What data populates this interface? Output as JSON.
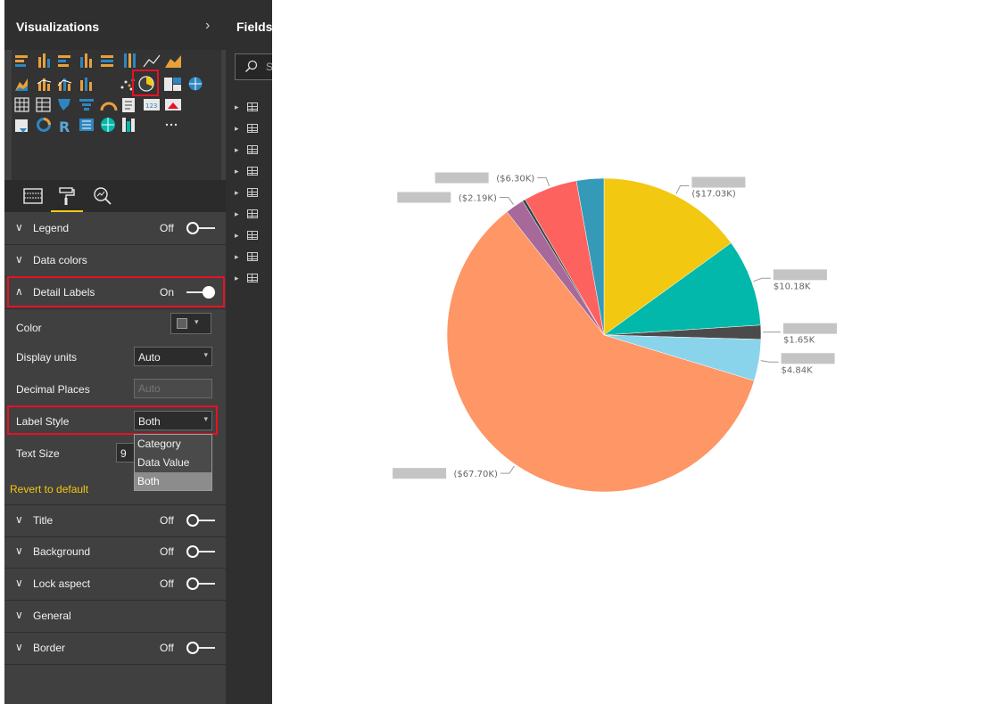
{
  "visualizations": {
    "title": "Visualizations",
    "collapse_icon": "chevron-right-icon",
    "tabs": [
      "fields-well-icon",
      "format-paint-roller-icon",
      "analytics-magnifier-icon"
    ],
    "icon_gallery": [
      "stacked-bar-icon",
      "stacked-column-icon",
      "clustered-bar-icon",
      "clustered-column-icon",
      "100-stacked-bar-icon",
      "100-stacked-column-icon",
      "line-chart-icon",
      "area-chart-icon",
      "stacked-area-icon",
      "line-clustered-column-icon",
      "line-stacked-column-icon",
      "ribbon-chart-icon",
      "scatter-chart-icon",
      "pie-chart-icon",
      "treemap-icon",
      "map-icon",
      "table-icon",
      "matrix-icon",
      "filled-map-icon",
      "funnel-icon",
      "gauge-icon",
      "multi-row-card-icon",
      "card-icon",
      "kpi-icon",
      "slicer-icon",
      "donut-chart-icon",
      "r-visual-icon",
      "shape-map-icon",
      "globe-map-icon",
      "custom-visual-icon",
      "more-icon"
    ],
    "selected_visual": "pie-chart-icon"
  },
  "format": {
    "legend": {
      "label": "Legend",
      "state": "Off"
    },
    "data_colors": {
      "label": "Data colors"
    },
    "detail_labels": {
      "label": "Detail Labels",
      "state": "On",
      "color": {
        "label": "Color",
        "swatch": "#5f5f5f"
      },
      "display_units": {
        "label": "Display units",
        "value": "Auto"
      },
      "decimal_places": {
        "label": "Decimal Places",
        "placeholder": "Auto"
      },
      "label_style": {
        "label": "Label Style",
        "value": "Both",
        "options": [
          "Category",
          "Data Value",
          "Both"
        ]
      },
      "text_size": {
        "label": "Text Size",
        "value": "9"
      },
      "revert": "Revert to default"
    },
    "title": {
      "label": "Title",
      "state": "Off"
    },
    "background": {
      "label": "Background",
      "state": "Off"
    },
    "lock_aspect": {
      "label": "Lock aspect",
      "state": "Off"
    },
    "general": {
      "label": "General"
    },
    "border": {
      "label": "Border",
      "state": "Off"
    }
  },
  "fields": {
    "title": "Fields",
    "search_placeholder": "S",
    "table_count": 9
  },
  "chart_data": {
    "type": "pie",
    "categories": [
      "",
      "",
      "",
      "",
      "",
      "",
      "",
      ""
    ],
    "values": [
      17.03,
      10.18,
      1.65,
      4.84,
      67.7,
      2.19,
      0.35,
      6.3,
      3.2
    ],
    "labels": [
      "($17.03K)",
      "$10.18K",
      "$1.65K",
      "$4.84K",
      "($67.70K)",
      "($2.19K)",
      "",
      "($6.30K)",
      ""
    ],
    "colors": [
      "#f2c811",
      "#01b8aa",
      "#4b4b4b",
      "#8ad4eb",
      "#fe9666",
      "#a66999",
      "#374649",
      "#fd625e",
      "#3599b8"
    ],
    "start": "top",
    "direction": "clockwise"
  }
}
